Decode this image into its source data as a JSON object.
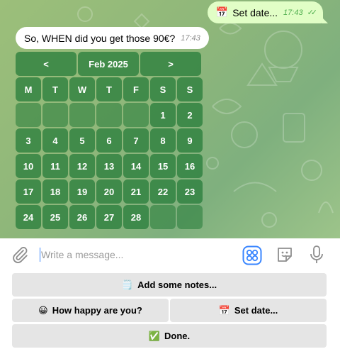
{
  "messages": {
    "outgoing": {
      "icon": "📅",
      "text": "Set date...",
      "time": "17:43",
      "status": "✓✓"
    },
    "incoming": {
      "text": "So, WHEN did you get those 90€?",
      "time": "17:43"
    }
  },
  "calendar": {
    "prev_label": "<",
    "month_label": "Feb 2025",
    "next_label": ">",
    "weekdays": [
      "M",
      "T",
      "W",
      "T",
      "F",
      "S",
      "S"
    ],
    "weeks": [
      [
        "",
        "",
        "",
        "",
        "",
        "1",
        "2"
      ],
      [
        "3",
        "4",
        "5",
        "6",
        "7",
        "8",
        "9"
      ],
      [
        "10",
        "11",
        "12",
        "13",
        "14",
        "15",
        "16"
      ],
      [
        "17",
        "18",
        "19",
        "20",
        "21",
        "22",
        "23"
      ],
      [
        "24",
        "25",
        "26",
        "27",
        "28",
        "",
        ""
      ]
    ]
  },
  "composer": {
    "placeholder": "Write a message...",
    "icons": [
      "paperclip-icon",
      "bot-command-icon",
      "sticker-icon",
      "microphone-icon"
    ]
  },
  "reply_keyboard": {
    "notes": {
      "icon": "🗒️",
      "label": "Add some notes..."
    },
    "happy": {
      "icon": "😀",
      "label": "How happy are you?"
    },
    "set_date": {
      "icon": "📅",
      "label": "Set date..."
    },
    "done": {
      "icon": "✅",
      "label": "Done."
    }
  },
  "colors": {
    "accent": "#3a86ff",
    "outgoing_bubble": "#e1fec6",
    "inline_button": "#2a7a37"
  }
}
